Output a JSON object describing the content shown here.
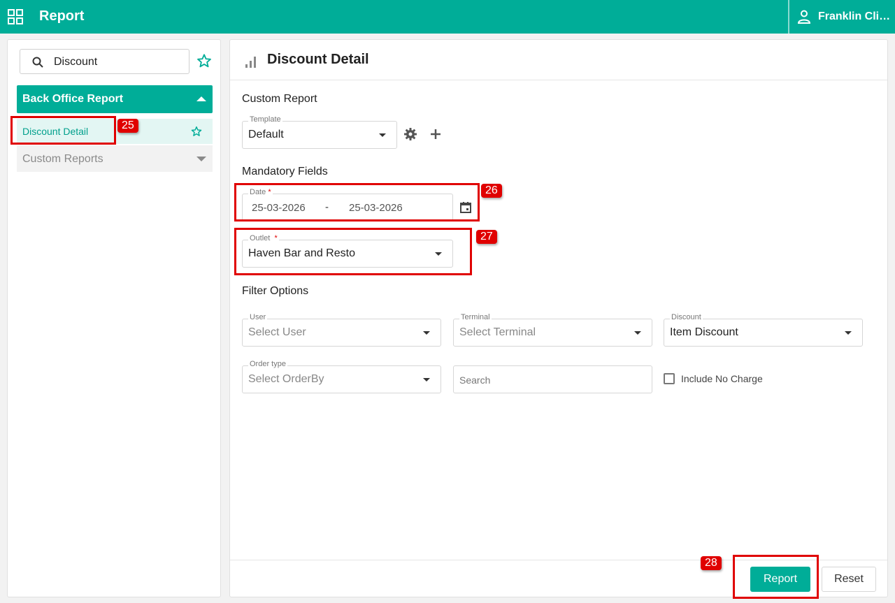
{
  "topbar": {
    "title": "Report",
    "user_name": "Franklin Clin..."
  },
  "sidebar": {
    "search_value": "Discount",
    "section_title": "Back Office Report",
    "active_item": "Discount Detail",
    "collapsed_item": "Custom Reports"
  },
  "main": {
    "title": "Discount Detail",
    "custom_report": {
      "heading": "Custom Report",
      "template_label": "Template",
      "template_value": "Default"
    },
    "mandatory": {
      "heading": "Mandatory Fields",
      "date_label": "Date",
      "date_from": "25-03-2026",
      "date_separator": "-",
      "date_to": "25-03-2026",
      "outlet_label": "Outlet",
      "outlet_value": "Haven Bar and Resto",
      "required_mark": "*"
    },
    "filters": {
      "heading": "Filter Options",
      "user_label": "User",
      "user_placeholder": "Select User",
      "terminal_label": "Terminal",
      "terminal_placeholder": "Select Terminal",
      "discount_label": "Discount",
      "discount_value": "Item Discount",
      "order_type_label": "Order type",
      "order_type_placeholder": "Select OrderBy",
      "search_placeholder": "Search",
      "include_no_charge": "Include No Charge"
    },
    "footer": {
      "report_button": "Report",
      "reset_button": "Reset"
    }
  },
  "annotations": [
    "25",
    "26",
    "27",
    "28"
  ],
  "colors": {
    "brand": "#00ad98",
    "annotation": "#e00000"
  }
}
